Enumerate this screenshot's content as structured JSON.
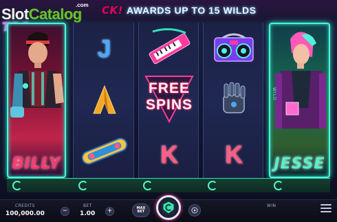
{
  "watermark": {
    "brand_slot": "Slot",
    "brand_catalog": "Catalog",
    "brand_com": ".com"
  },
  "game_logo": "TRO",
  "banner": {
    "fragment": "CK!",
    "text": "AWARDS UP TO 15 WILDS"
  },
  "reels": {
    "wild_left_name": "BILLY",
    "wild_right_name": "JESSE",
    "side_text": "WILD",
    "symbols": [
      {
        "reel": 2,
        "row": 1,
        "type": "letter",
        "label": "J"
      },
      {
        "reel": 2,
        "row": 2,
        "type": "icon",
        "icon": "pyramid-icon"
      },
      {
        "reel": 2,
        "row": 3,
        "type": "icon",
        "icon": "hoverboard-icon"
      },
      {
        "reel": 3,
        "row": 1,
        "type": "icon",
        "icon": "keytar-icon"
      },
      {
        "reel": 3,
        "row": 2,
        "type": "scatter",
        "line1": "FREE",
        "line2": "SPINS"
      },
      {
        "reel": 3,
        "row": 3,
        "type": "letter",
        "label": "K"
      },
      {
        "reel": 4,
        "row": 1,
        "type": "icon",
        "icon": "boombox-icon"
      },
      {
        "reel": 4,
        "row": 2,
        "type": "icon",
        "icon": "robot-glove-icon"
      },
      {
        "reel": 4,
        "row": 3,
        "type": "letter",
        "label": "K"
      }
    ]
  },
  "controls": {
    "credits_label": "CREDITS",
    "credits_value": "100,000.00",
    "bet_label": "BET",
    "bet_value": "1.00",
    "minus": "−",
    "plus": "+",
    "max_bet_line1": "MAX",
    "max_bet_line2": "BET",
    "win_label": "WIN"
  },
  "colors": {
    "accent_teal": "#4ef3d8",
    "accent_pink": "#ff3a6f",
    "spin_glow": "#ff3fae"
  }
}
